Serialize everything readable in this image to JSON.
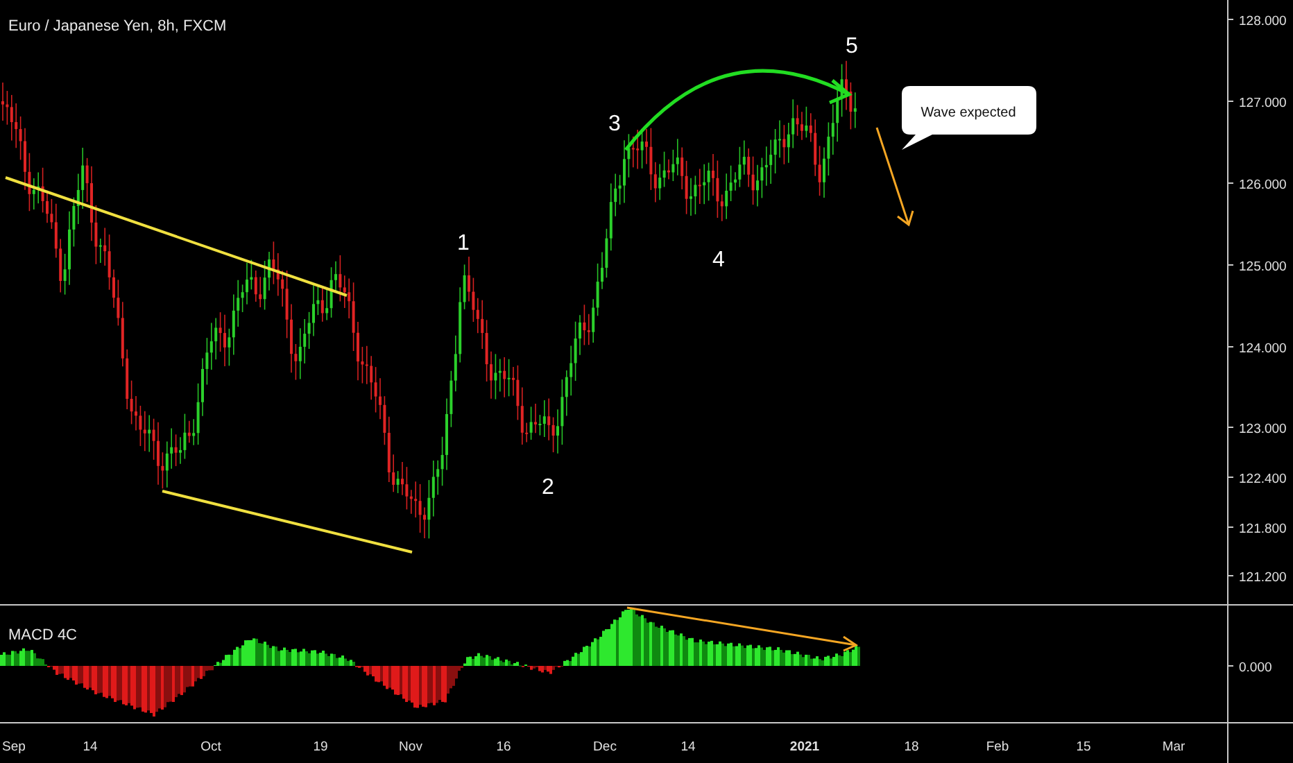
{
  "chart": {
    "title": "Euro / Japanese Yen, 8h, FXCM",
    "price_axis": [
      "128.000",
      "127.000",
      "126.000",
      "125.000",
      "124.000",
      "123.000",
      "122.400",
      "121.800",
      "121.200"
    ],
    "wave_labels": [
      "1",
      "2",
      "3",
      "4",
      "5"
    ],
    "callout": "Wave expected"
  },
  "indicator": {
    "label": "MACD 4C",
    "axis": [
      "0.000"
    ]
  },
  "time_axis": [
    {
      "label": "Sep",
      "emphasized": false
    },
    {
      "label": "14",
      "emphasized": false
    },
    {
      "label": "Oct",
      "emphasized": false
    },
    {
      "label": "19",
      "emphasized": false
    },
    {
      "label": "Nov",
      "emphasized": false
    },
    {
      "label": "16",
      "emphasized": false
    },
    {
      "label": "Dec",
      "emphasized": false
    },
    {
      "label": "14",
      "emphasized": false
    },
    {
      "label": "2021",
      "emphasized": true
    },
    {
      "label": "18",
      "emphasized": false
    },
    {
      "label": "Feb",
      "emphasized": false
    },
    {
      "label": "15",
      "emphasized": false
    },
    {
      "label": "Mar",
      "emphasized": false
    }
  ]
}
